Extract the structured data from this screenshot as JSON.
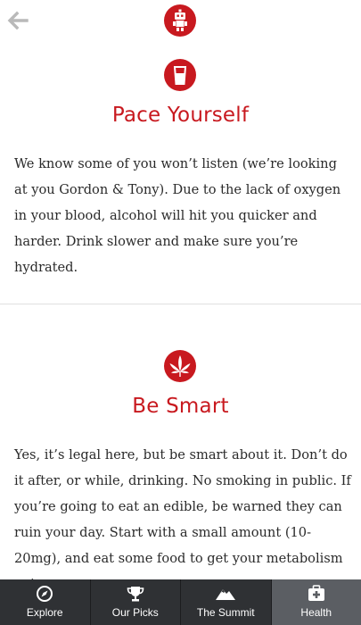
{
  "accent_color": "#c8191f",
  "header": {
    "back_icon": "back-arrow-icon",
    "logo_icon": "robot-logo-icon"
  },
  "sections": [
    {
      "icon": "glass-icon",
      "title": "Pace Yourself",
      "body": "We know some of you won’t listen (we’re looking at you Gordon & Tony). Due to the lack of oxygen in your blood, alcohol will hit you quicker and harder. Drink slower and make sure you’re hydrated."
    },
    {
      "icon": "cannabis-leaf-icon",
      "title": "Be Smart",
      "body": "Yes, it’s legal here, but be smart about it. Don’t do it after, or while, drinking. No smoking in public. If you’re going to eat an edible, be warned they can ruin your day. Start with a small amount (10-20mg), and eat some food to get your metabolism going."
    }
  ],
  "tabbar": {
    "active": "Health",
    "tabs": [
      {
        "label": "Explore",
        "icon": "compass-icon"
      },
      {
        "label": "Our Picks",
        "icon": "trophy-icon"
      },
      {
        "label": "The Summit",
        "icon": "mountain-icon"
      },
      {
        "label": "Health",
        "icon": "first-aid-icon"
      }
    ]
  }
}
